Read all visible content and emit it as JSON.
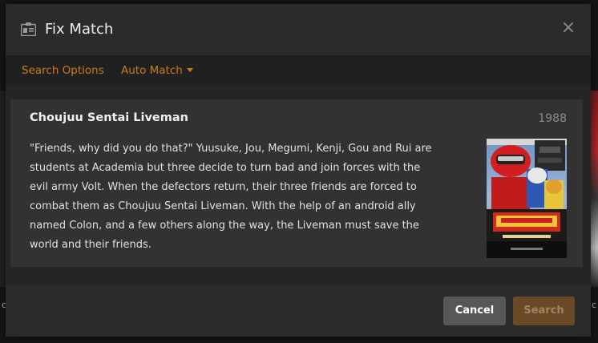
{
  "dialog": {
    "title": "Fix Match",
    "close_symbol": "×",
    "title_icon": "id-card-icon",
    "close_icon": "close-icon"
  },
  "tabs": [
    {
      "label": "Search Options"
    },
    {
      "label": "Auto Match",
      "dropdown": true
    }
  ],
  "result": {
    "title": "Choujuu Sentai Liveman",
    "year": "1988",
    "summary": "\"Friends, why did you do that?\" Yuusuke, Jou, Megumi, Kenji, Gou and Rui are students at Academia but three decide to turn bad and join forces with the evil army Volt. When the defectors return, their three friends are forced to combat them as Choujuu Sentai Liveman. With the help of an android ally named Colon, and a few others along the way, the Liveman must save the world and their friends."
  },
  "footer": {
    "cancel_label": "Cancel",
    "search_label": "Search"
  },
  "background": {
    "left_letter": "c",
    "right_letter": "c"
  },
  "colors": {
    "accent": "#cc7b19",
    "modal_bg": "#282828",
    "result_bg": "#323232",
    "cancel_bg": "#575757",
    "search_bg_disabled": "#6a4a26"
  }
}
